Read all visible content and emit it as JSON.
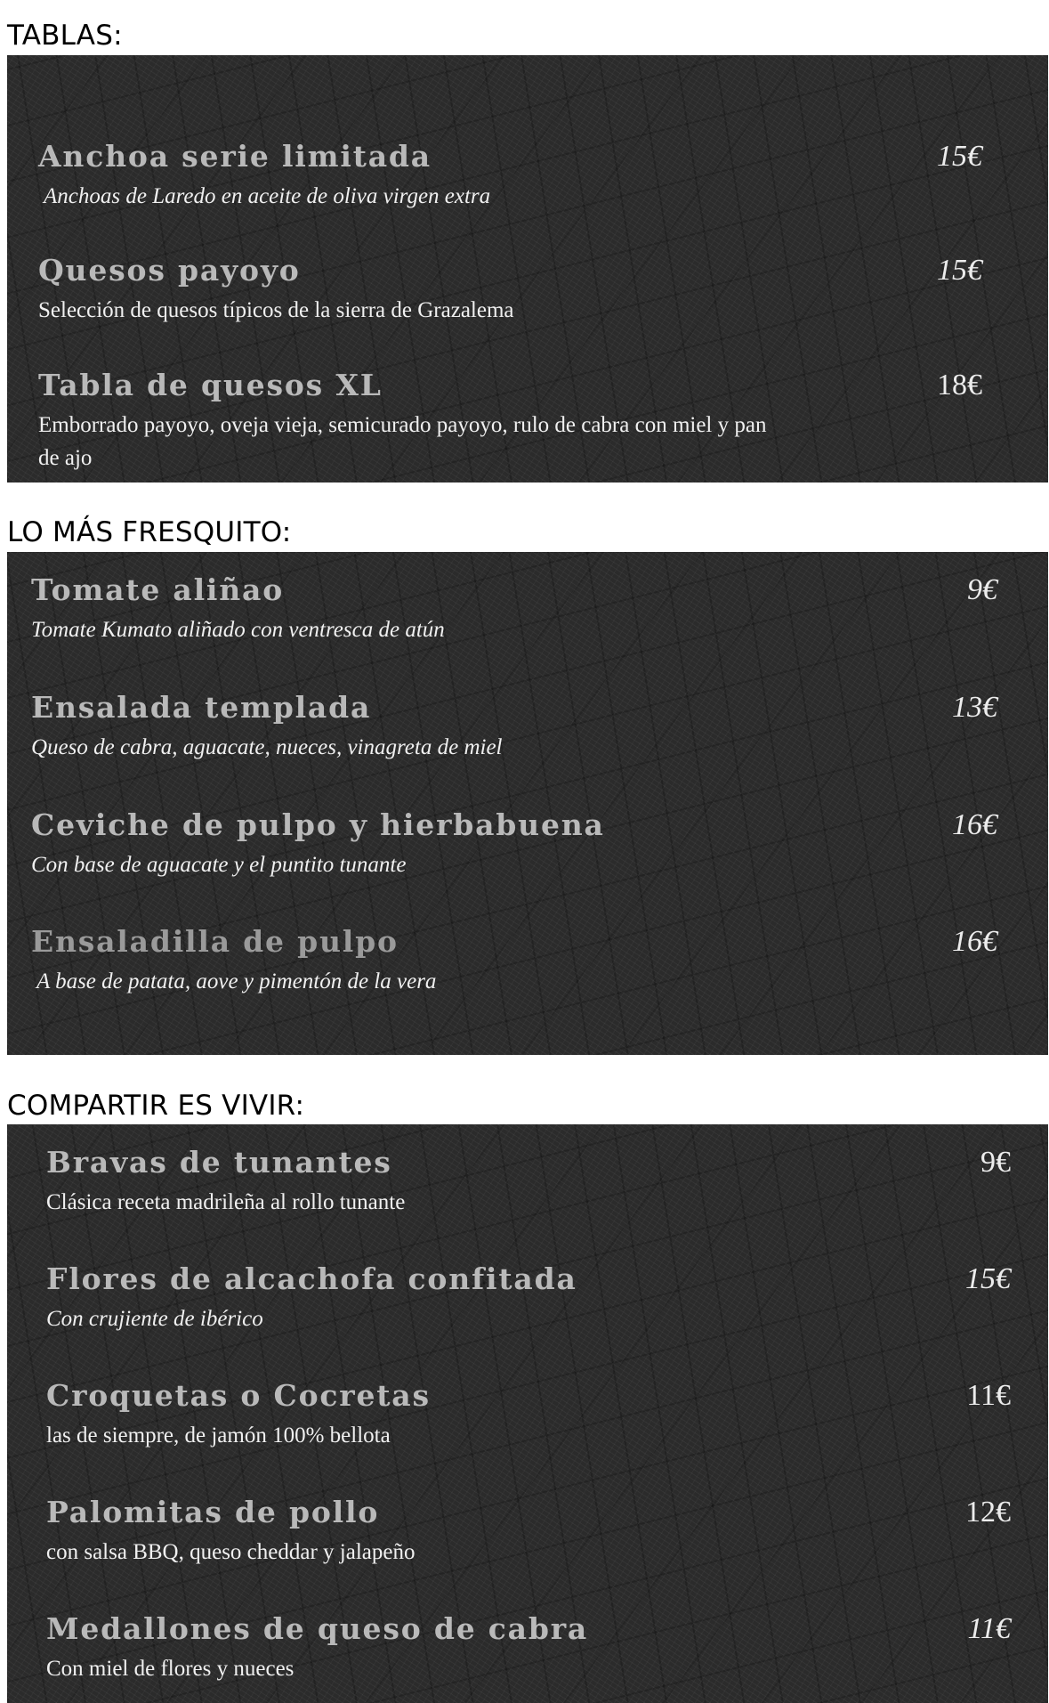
{
  "sections": [
    {
      "heading": "TABLAS:",
      "items": [
        {
          "name": "Anchoa serie limitada",
          "price": "15€",
          "description": "Anchoas de Laredo en aceite de oliva virgen extra"
        },
        {
          "name": "Quesos payoyo",
          "price": "15€",
          "description": "Selección de quesos típicos de la sierra de Grazalema"
        },
        {
          "name": "Tabla de quesos XL",
          "price": "18€",
          "description": "Emborrado payoyo, oveja vieja, semicurado payoyo, rulo de cabra con miel y pan de ajo"
        }
      ]
    },
    {
      "heading": "LO MÁS FRESQUITO:",
      "items": [
        {
          "name": "Tomate aliñao",
          "price": "9€",
          "description": "Tomate Kumato aliñado con ventresca de atún"
        },
        {
          "name": "Ensalada templada",
          "price": "13€",
          "description": "Queso de cabra, aguacate, nueces, vinagreta de miel"
        },
        {
          "name": "Ceviche de pulpo y hierbabuena",
          "price": "16€",
          "description": "Con base de aguacate y el puntito tunante"
        },
        {
          "name": "Ensaladilla de pulpo",
          "price": "16€",
          "description": "A base de patata, aove y pimentón de la vera"
        }
      ]
    },
    {
      "heading": "COMPARTIR ES VIVIR:",
      "items": [
        {
          "name": "Bravas de tunantes",
          "price": "9€",
          "description": "Clásica receta madrileña al rollo tunante"
        },
        {
          "name": "Flores de alcachofa confitada",
          "price": "15€",
          "description": "Con crujiente de ibérico"
        },
        {
          "name": "Croquetas o Cocretas",
          "price": "11€",
          "description": "las de siempre, de jamón 100% bellota"
        },
        {
          "name": "Palomitas de pollo",
          "price": "12€",
          "description": "con salsa BBQ, queso cheddar y jalapeño"
        },
        {
          "name": "Medallones de queso de cabra",
          "price": "11€",
          "description": "Con miel de flores y nueces"
        }
      ]
    }
  ]
}
